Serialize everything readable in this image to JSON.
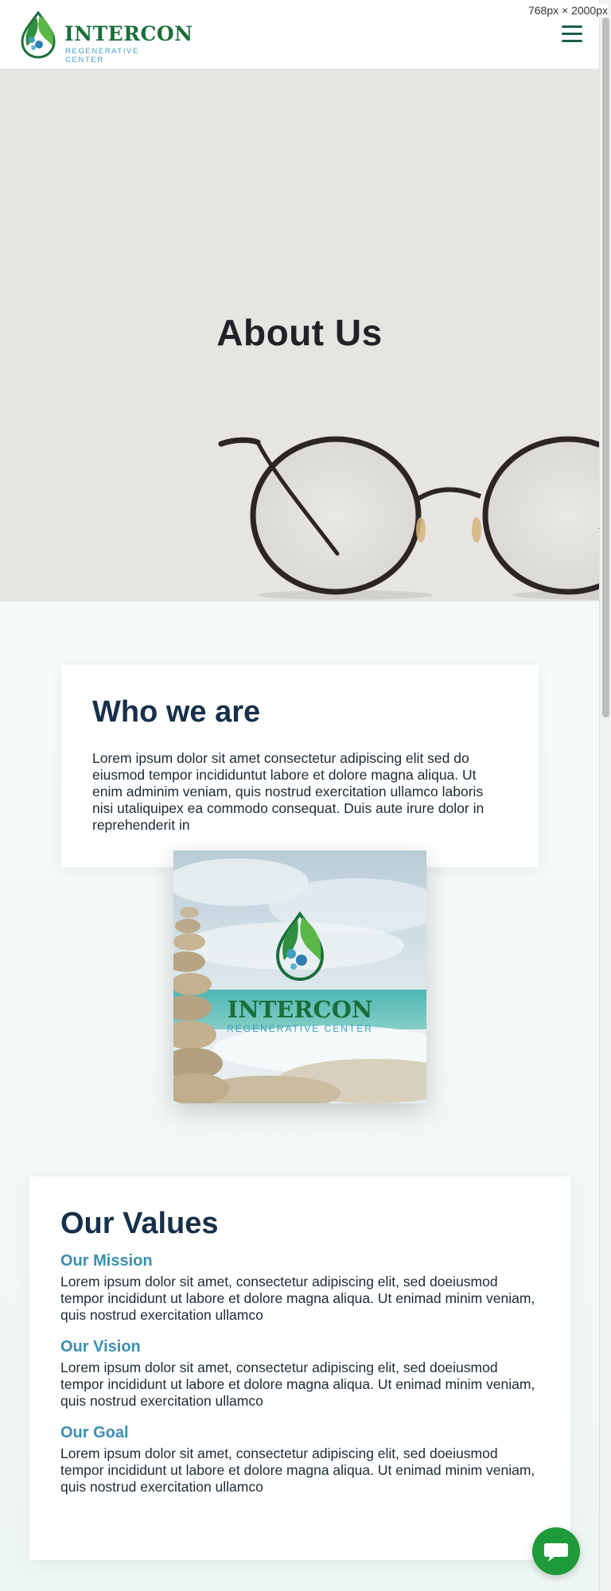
{
  "viewport_label": "768px × 2000px",
  "brand": {
    "name": "INTERCON",
    "tagline": "REGENERATIVE CENTER"
  },
  "hero": {
    "title": "About Us"
  },
  "who": {
    "title": "Who we are",
    "text": "Lorem ipsum dolor sit amet consectetur adipiscing elit sed do eiusmod tempor incididuntut labore et dolore magna aliqua. Ut enim adminim veniam, quis nostrud exercitation ullamco laboris nisi utaliquipex ea commodo consequat. Duis aute irure dolor in reprehenderit in"
  },
  "image_brand": {
    "name": "INTERCON",
    "tagline": "REGENERATIVE CENTER"
  },
  "values": {
    "title": "Our Values",
    "items": [
      {
        "heading": "Our Mission",
        "text": "Lorem ipsum dolor sit amet, consectetur adipiscing elit, sed doeiusmod tempor incididunt ut labore et dolore magna aliqua. Ut enimad minim veniam, quis nostrud exercitation ullamco"
      },
      {
        "heading": "Our Vision",
        "text": "Lorem ipsum dolor sit amet, consectetur adipiscing elit, sed doeiusmod tempor incididunt ut labore et dolore magna aliqua. Ut enimad minim veniam, quis nostrud exercitation ullamco"
      },
      {
        "heading": "Our Goal",
        "text": "Lorem ipsum dolor sit amet, consectetur adipiscing elit, sed doeiusmod tempor incididunt ut labore et dolore magna aliqua. Ut enimad minim veniam, quis nostrud exercitation ullamco"
      }
    ]
  },
  "icons": {
    "menu": "hamburger-menu-icon",
    "chat": "chat-bubble-icon",
    "logo": "water-drop-leaf-logo"
  },
  "colors": {
    "brand_green": "#1b6e3a",
    "brand_blue": "#3fa0c0",
    "heading_navy": "#173049",
    "accent_blue": "#3b8fb0",
    "chat_green": "#1f9a3a"
  }
}
